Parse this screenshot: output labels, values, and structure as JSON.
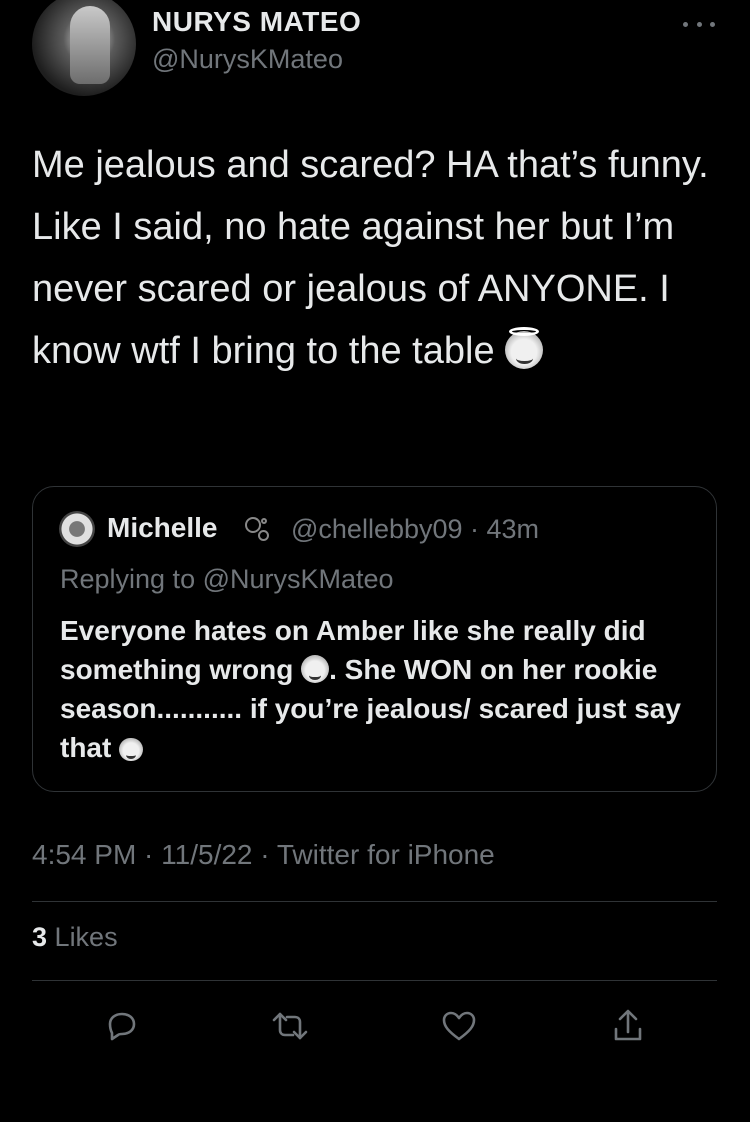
{
  "author": {
    "display_name": "NURYS MATEO",
    "handle": "@NurysKMateo"
  },
  "tweet": {
    "text": "Me jealous and scared? HA that’s funny. Like I said, no hate against her but I’m never scared or jealous of ANYONE. I know wtf I bring to the table",
    "emoji": "smiling-face-with-halo"
  },
  "quoted_tweet": {
    "name": "Michelle",
    "badge": "circles-icon",
    "meta": "@chellebby09 · 43m",
    "replying_to": "Replying to @NurysKMateo",
    "text_part1": "Everyone hates on Amber like she really did something wrong",
    "text_part2": ". She WON on her rookie season........... if you’re jealous/ scared just say that",
    "emojis": [
      "clown-face",
      "person-shrugging"
    ]
  },
  "timestamp": "4:54 PM · 11/5/22 · Twitter for iPhone",
  "likes": {
    "count": "3",
    "label": "Likes"
  },
  "actions": [
    "reply-icon",
    "retweet-icon",
    "like-icon",
    "share-icon"
  ],
  "colors": {
    "background": "#000000",
    "text": "#e7e9ea",
    "secondary": "#71767b",
    "border": "#2f3336"
  }
}
